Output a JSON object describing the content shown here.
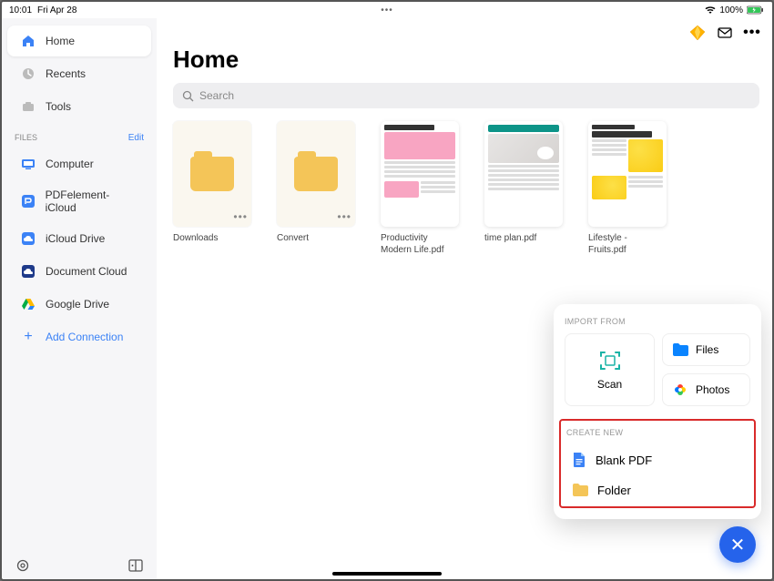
{
  "status": {
    "time": "10:01",
    "date": "Fri Apr 28",
    "battery": "100%"
  },
  "sidebar": {
    "nav": [
      {
        "label": "Home",
        "icon": "home",
        "sel": true
      },
      {
        "label": "Recents",
        "icon": "clock"
      },
      {
        "label": "Tools",
        "icon": "tools"
      }
    ],
    "files_header": "FILES",
    "files_edit": "Edit",
    "locations": [
      {
        "label": "Computer",
        "icon": "computer"
      },
      {
        "label": "PDFelement-iCloud",
        "icon": "pdfelement"
      },
      {
        "label": "iCloud Drive",
        "icon": "icloud"
      },
      {
        "label": "Document Cloud",
        "icon": "doccloud"
      },
      {
        "label": "Google Drive",
        "icon": "gdrive"
      }
    ],
    "add_connection": "Add Connection"
  },
  "main": {
    "title": "Home",
    "search_placeholder": "Search",
    "items": [
      {
        "name": "Downloads",
        "type": "folder"
      },
      {
        "name": "Convert",
        "type": "folder"
      },
      {
        "name": "Productivity Modern Life.pdf",
        "type": "doc",
        "variant": "pink"
      },
      {
        "name": "time plan.pdf",
        "type": "doc",
        "variant": "plan"
      },
      {
        "name": "Lifestyle - Fruits.pdf",
        "type": "doc",
        "variant": "fruits"
      }
    ]
  },
  "popup": {
    "import_label": "IMPORT FROM",
    "scan": "Scan",
    "files": "Files",
    "photos": "Photos",
    "create_label": "CREATE NEW",
    "blank_pdf": "Blank PDF",
    "folder": "Folder"
  }
}
